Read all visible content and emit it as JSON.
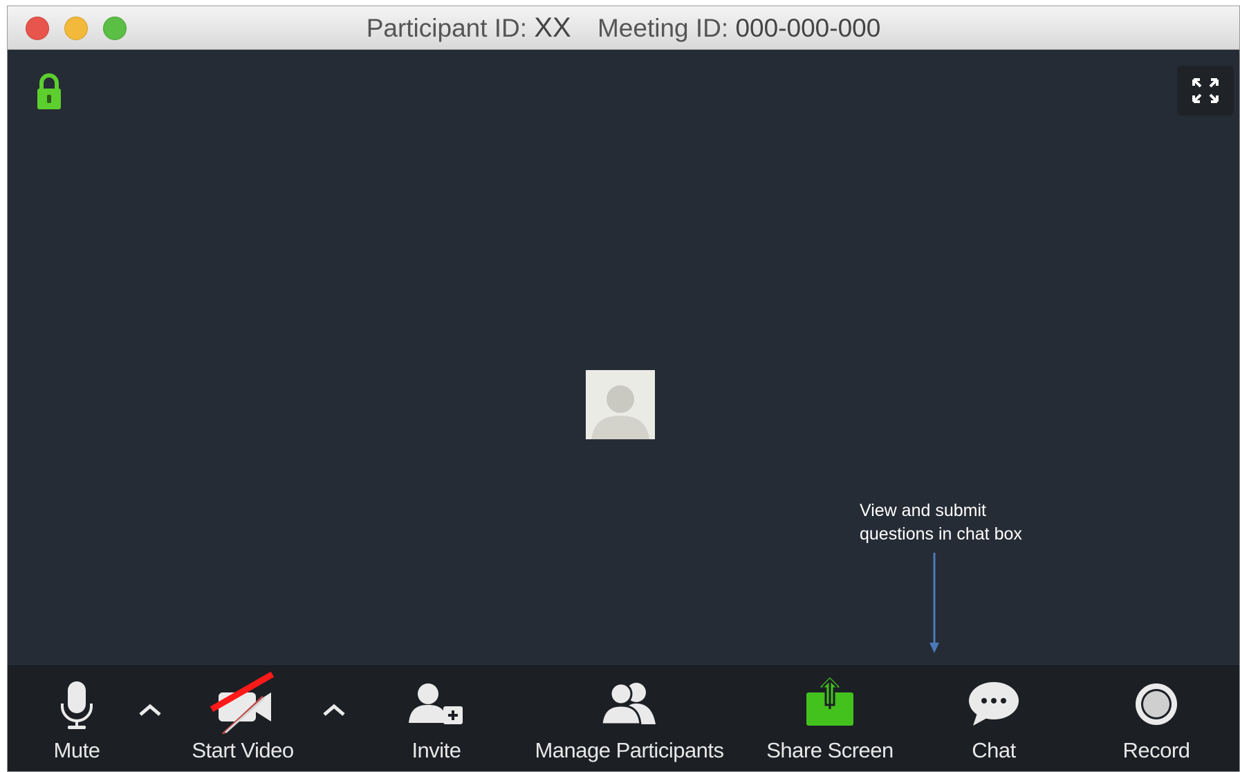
{
  "window": {
    "title_participant_label": "Participant ID:",
    "title_participant_value": "XX",
    "title_meeting_label": "Meeting ID:",
    "title_meeting_value": "000-000-000"
  },
  "annotation": {
    "line1": "View and submit",
    "line2": "questions in chat box"
  },
  "toolbar": {
    "mute_label": "Mute",
    "video_label": "Start Video",
    "invite_label": "Invite",
    "participants_label": "Manage Participants",
    "share_label": "Share Screen",
    "chat_label": "Chat",
    "record_label": "Record"
  },
  "colors": {
    "background": "#262c35",
    "toolbar": "#1c1f24",
    "share_green": "#43c11c",
    "lock_green": "#5ccf2f",
    "slash_red": "#ff1a1a",
    "arrow_blue": "#4a7ab8"
  },
  "icons": [
    "lock-icon",
    "fullscreen-icon",
    "avatar-placeholder-icon",
    "microphone-icon",
    "camera-icon",
    "invite-icon",
    "participants-icon",
    "share-screen-icon",
    "chat-bubble-icon",
    "record-icon",
    "caret-up-icon"
  ]
}
